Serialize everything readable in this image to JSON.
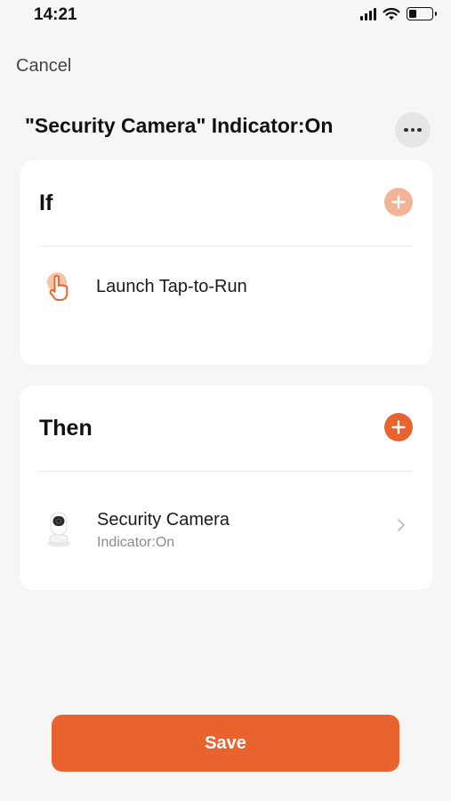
{
  "status_bar": {
    "time": "14:21",
    "icons": [
      "signal-icon",
      "wifi-icon",
      "battery-icon"
    ],
    "battery_level": 0.35
  },
  "header": {
    "cancel_label": "Cancel",
    "title": "\"Security Camera\" Indicator:On",
    "more_icon": "more-horizontal-icon"
  },
  "if_section": {
    "heading": "If",
    "add_icon": "plus-icon",
    "condition": {
      "icon": "tap-hand-icon",
      "label": "Launch Tap-to-Run"
    }
  },
  "then_section": {
    "heading": "Then",
    "add_icon": "plus-icon",
    "action": {
      "icon": "security-camera-icon",
      "title": "Security Camera",
      "subtitle": "Indicator:On",
      "chevron_icon": "chevron-right-icon"
    }
  },
  "footer": {
    "save_label": "Save"
  },
  "colors": {
    "accent": "#e8632d",
    "accent_faded": "#f3b496",
    "background": "#f6f6f6",
    "card": "#ffffff"
  }
}
